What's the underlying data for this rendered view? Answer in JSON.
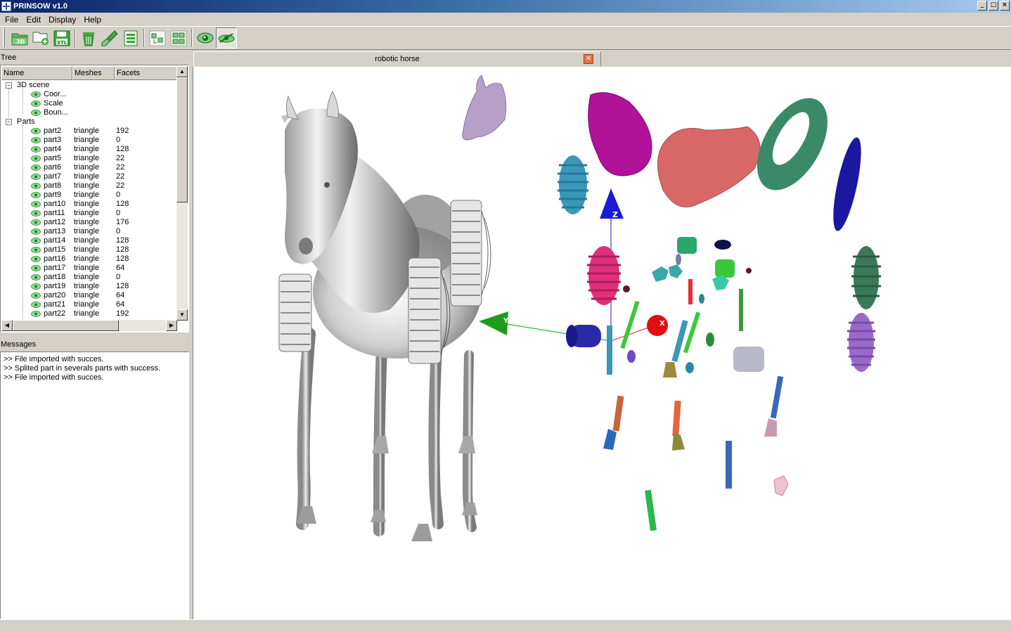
{
  "window": {
    "title": "PRINSOW v1.0",
    "buttons": [
      "_",
      "□",
      "×"
    ]
  },
  "menu": [
    "File",
    "Edit",
    "Display",
    "Help"
  ],
  "toolbar": {
    "groups": [
      [
        {
          "icon": "open-3d-icon",
          "label": "3D"
        },
        {
          "icon": "add-folder-icon",
          "label": ""
        },
        {
          "icon": "save-stl-icon",
          "label": "STL"
        }
      ],
      [
        {
          "icon": "trash-icon",
          "label": ""
        },
        {
          "icon": "brush-icon",
          "label": ""
        },
        {
          "icon": "notes-icon",
          "label": ""
        }
      ],
      [
        {
          "icon": "split-parts-icon",
          "label": ""
        },
        {
          "icon": "arrange-parts-icon",
          "label": ""
        }
      ],
      [
        {
          "icon": "view-eye-icon",
          "label": ""
        },
        {
          "icon": "fly-view-icon",
          "label": "",
          "pressed": true
        }
      ]
    ]
  },
  "tree": {
    "title": "Tree",
    "columns": [
      "Name",
      "Meshes",
      "Facets"
    ],
    "scene_label": "3D scene",
    "scene_children": [
      "Coor...",
      "Scale",
      "Boun..."
    ],
    "parts_label": "Parts",
    "parts": [
      {
        "name": "part2",
        "mesh": "triangle",
        "facets": "192"
      },
      {
        "name": "part3",
        "mesh": "triangle",
        "facets": "0"
      },
      {
        "name": "part4",
        "mesh": "triangle",
        "facets": "128"
      },
      {
        "name": "part5",
        "mesh": "triangle",
        "facets": "22"
      },
      {
        "name": "part6",
        "mesh": "triangle",
        "facets": "22"
      },
      {
        "name": "part7",
        "mesh": "triangle",
        "facets": "22"
      },
      {
        "name": "part8",
        "mesh": "triangle",
        "facets": "22"
      },
      {
        "name": "part9",
        "mesh": "triangle",
        "facets": "0"
      },
      {
        "name": "part10",
        "mesh": "triangle",
        "facets": "128"
      },
      {
        "name": "part11",
        "mesh": "triangle",
        "facets": "0"
      },
      {
        "name": "part12",
        "mesh": "triangle",
        "facets": "176"
      },
      {
        "name": "part13",
        "mesh": "triangle",
        "facets": "0"
      },
      {
        "name": "part14",
        "mesh": "triangle",
        "facets": "128"
      },
      {
        "name": "part15",
        "mesh": "triangle",
        "facets": "128"
      },
      {
        "name": "part16",
        "mesh": "triangle",
        "facets": "128"
      },
      {
        "name": "part17",
        "mesh": "triangle",
        "facets": "64"
      },
      {
        "name": "part18",
        "mesh": "triangle",
        "facets": "0"
      },
      {
        "name": "part19",
        "mesh": "triangle",
        "facets": "128"
      },
      {
        "name": "part20",
        "mesh": "triangle",
        "facets": "64"
      },
      {
        "name": "part21",
        "mesh": "triangle",
        "facets": "64"
      },
      {
        "name": "part22",
        "mesh": "triangle",
        "facets": "192"
      }
    ]
  },
  "messages": {
    "title": "Messages",
    "lines": [
      ">> File imported with succes.",
      ">> Splited part in severals parts with success.",
      ">> File imported with succes."
    ]
  },
  "viewer": {
    "tab_title": "robotic horse",
    "axis_labels": {
      "y": "Y",
      "z": "Z",
      "x": "X"
    }
  },
  "colors": {
    "titlebar_start": "#0a246a",
    "titlebar_end": "#a6caf0",
    "eye_green": "#3aaa3a",
    "tab_close": "#e8704a"
  }
}
